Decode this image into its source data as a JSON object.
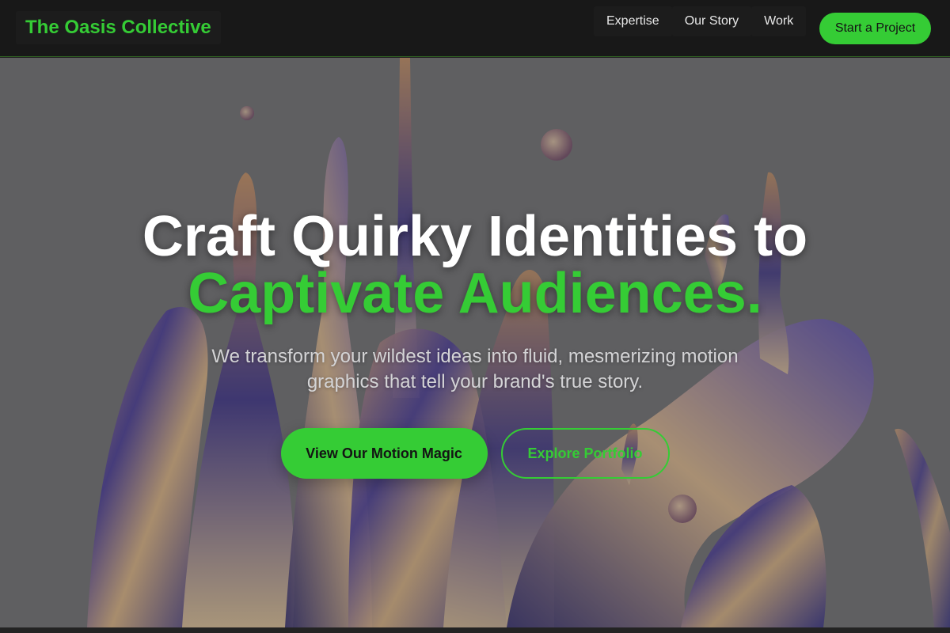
{
  "nav": {
    "brand": "The Oasis Collective",
    "links": [
      {
        "label": "Expertise"
      },
      {
        "label": "Our Story"
      },
      {
        "label": "Work"
      }
    ],
    "cta_label": "Start a Project"
  },
  "hero": {
    "headline_line1": "Craft Quirky Identities to",
    "headline_line2": "Captivate Audiences.",
    "subheadline": "We transform your wildest ideas into fluid, mesmerizing motion graphics that tell your brand's true story.",
    "primary_button": "View Our Motion Magic",
    "secondary_button": "Explore Portfolio",
    "background": "abstract liquid splash artwork"
  },
  "colors": {
    "accent": "#35cc35",
    "nav_background": "#181818",
    "headline": "#ffffff",
    "subheadline": "#d4d4d6"
  }
}
